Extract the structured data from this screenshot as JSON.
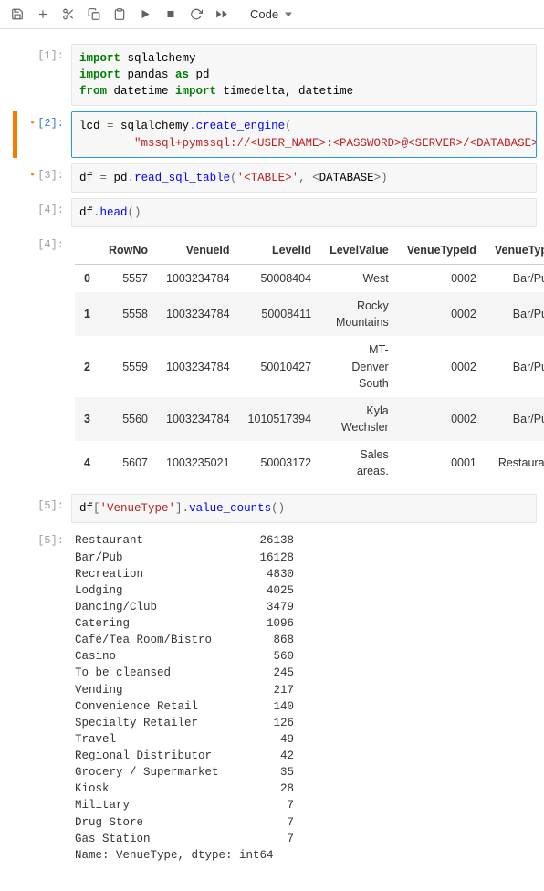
{
  "toolbar": {
    "save": "Save",
    "add": "Insert cell",
    "cut": "Cut",
    "copy": "Copy",
    "paste": "Paste",
    "run": "Run",
    "stop": "Interrupt",
    "restart": "Restart",
    "ff": "Restart and run all",
    "celltype": "Code"
  },
  "cells": [
    {
      "prompt": "[1]:",
      "modified": false,
      "selected": false,
      "lines": [
        [
          [
            "kw",
            "import"
          ],
          [
            "nm",
            " sqlalchemy"
          ]
        ],
        [
          [
            "kw",
            "import"
          ],
          [
            "nm",
            " pandas "
          ],
          [
            "kw",
            "as"
          ],
          [
            "nm",
            " pd"
          ]
        ],
        [
          [
            "kw",
            "from"
          ],
          [
            "nm",
            " datetime "
          ],
          [
            "kw",
            "import"
          ],
          [
            "nm",
            " timedelta, datetime"
          ]
        ]
      ]
    },
    {
      "prompt": "[2]:",
      "modified": true,
      "selected": true,
      "lines": [
        [
          [
            "nm",
            "lcd "
          ],
          [
            "op",
            "="
          ],
          [
            "nm",
            " sqlalchemy"
          ],
          [
            "op",
            "."
          ],
          [
            "fn",
            "create_engine"
          ],
          [
            "op",
            "("
          ]
        ],
        [
          [
            "nm",
            "        "
          ],
          [
            "str",
            "\"mssql+pymssql://<USER_NAME>:<PASSWORD>@<SERVER>/<DATABASE>\""
          ],
          [
            "op",
            ")"
          ]
        ]
      ]
    },
    {
      "prompt": "[3]:",
      "modified": true,
      "selected": false,
      "lines": [
        [
          [
            "nm",
            "df "
          ],
          [
            "op",
            "="
          ],
          [
            "nm",
            " pd"
          ],
          [
            "op",
            "."
          ],
          [
            "fn",
            "read_sql_table"
          ],
          [
            "op",
            "("
          ],
          [
            "str",
            "'<TABLE>'"
          ],
          [
            "op",
            ", <"
          ],
          [
            "nm",
            "DATABASE"
          ],
          [
            "op",
            ">)"
          ]
        ]
      ]
    },
    {
      "prompt": "[4]:",
      "modified": false,
      "selected": false,
      "lines": [
        [
          [
            "nm",
            "df"
          ],
          [
            "op",
            "."
          ],
          [
            "fn",
            "head"
          ],
          [
            "op",
            "()"
          ]
        ]
      ]
    }
  ],
  "df_output": {
    "prompt": "[4]:",
    "columns": [
      "",
      "RowNo",
      "VenueId",
      "LevelId",
      "LevelValue",
      "VenueTypeId",
      "VenueType"
    ],
    "rows": [
      [
        "0",
        "5557",
        "1003234784",
        "50008404",
        "West",
        "0002",
        "Bar/Pub"
      ],
      [
        "1",
        "5558",
        "1003234784",
        "50008411",
        "Rocky Mountains",
        "0002",
        "Bar/Pub"
      ],
      [
        "2",
        "5559",
        "1003234784",
        "50010427",
        "MT- Denver South",
        "0002",
        "Bar/Pub"
      ],
      [
        "3",
        "5560",
        "1003234784",
        "1010517394",
        "Kyla Wechsler",
        "0002",
        "Bar/Pub"
      ],
      [
        "4",
        "5607",
        "1003235021",
        "50003172",
        "Sales areas.",
        "0001",
        "Restaurant"
      ]
    ]
  },
  "cell5": {
    "prompt": "[5]:",
    "lines": [
      [
        [
          "nm",
          "df"
        ],
        [
          "op",
          "["
        ],
        [
          "str",
          "'VenueType'"
        ],
        [
          "op",
          "]."
        ],
        [
          "fn",
          "value_counts"
        ],
        [
          "op",
          "()"
        ]
      ]
    ]
  },
  "vc_output": {
    "prompt": "[5]:",
    "rows": [
      [
        "Restaurant",
        "26138"
      ],
      [
        "Bar/Pub",
        "16128"
      ],
      [
        "Recreation",
        "4830"
      ],
      [
        "Lodging",
        "4025"
      ],
      [
        "Dancing/Club",
        "3479"
      ],
      [
        "Catering",
        "1096"
      ],
      [
        "Café/Tea Room/Bistro",
        "868"
      ],
      [
        "Casino",
        "560"
      ],
      [
        "To be cleansed",
        "245"
      ],
      [
        "Vending",
        "217"
      ],
      [
        "Convenience Retail",
        "140"
      ],
      [
        "Specialty Retailer",
        "126"
      ],
      [
        "Travel",
        "49"
      ],
      [
        "Regional Distributor",
        "42"
      ],
      [
        "Grocery / Supermarket",
        "35"
      ],
      [
        "Kiosk",
        "28"
      ],
      [
        "Military",
        "7"
      ],
      [
        "Drug Store",
        "7"
      ],
      [
        "Gas Station",
        "7"
      ]
    ],
    "footer": "Name: VenueType, dtype: int64"
  }
}
